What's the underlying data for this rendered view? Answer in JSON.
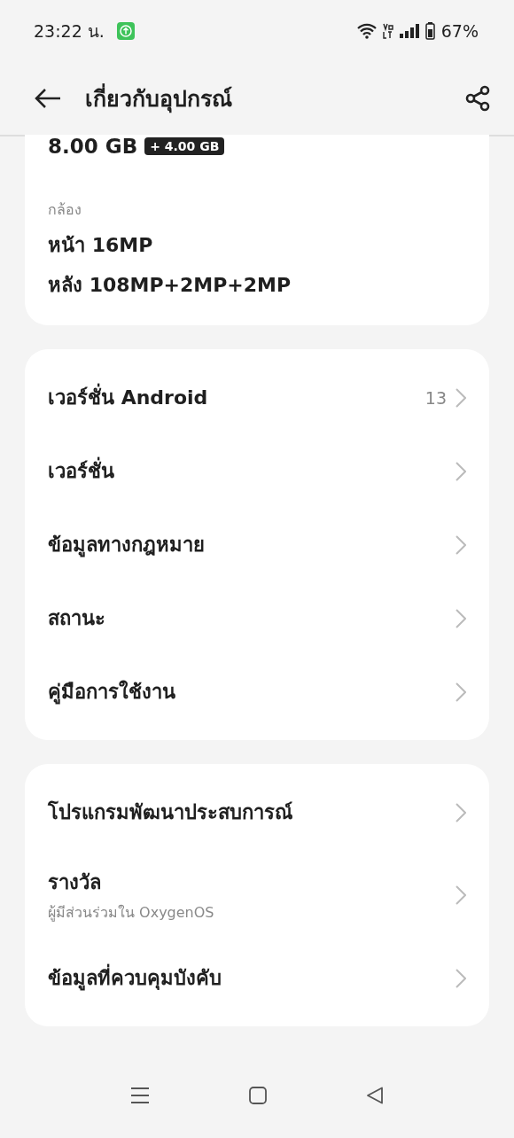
{
  "status_bar": {
    "time": "23:22 น.",
    "battery": "67%"
  },
  "header": {
    "title": "เกี่ยวกับอุปกรณ์"
  },
  "spec_card": {
    "memory": "8.00 GB",
    "memory_extra": "+ 4.00 GB",
    "camera_label": "กล้อง",
    "camera_lines": [
      "หน้า 16MP",
      "หลัง 108MP+2MP+2MP"
    ]
  },
  "groups": [
    {
      "items": [
        {
          "title": "เวอร์ชั่น Android",
          "value": "13"
        },
        {
          "title": "เวอร์ชั่น"
        },
        {
          "title": "ข้อมูลทางกฎหมาย"
        },
        {
          "title": "สถานะ"
        },
        {
          "title": "คู่มือการใช้งาน"
        }
      ]
    },
    {
      "items": [
        {
          "title": "โปรแกรมพัฒนาประสบการณ์"
        },
        {
          "title": "รางวัล",
          "subtitle": "ผู้มีส่วนร่วมใน OxygenOS"
        },
        {
          "title": "ข้อมูลที่ควบคุมบังคับ"
        }
      ]
    }
  ]
}
